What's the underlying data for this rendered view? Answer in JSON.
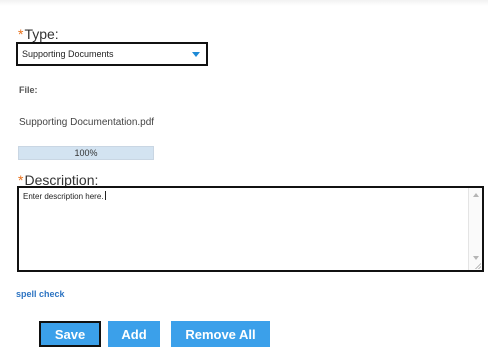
{
  "type_field": {
    "required_marker": "*",
    "label": "Type:",
    "selected": "Supporting Documents",
    "accent_color": "#1e8ad6"
  },
  "file_field": {
    "label": "File:",
    "file_name": "Supporting Documentation.pdf",
    "progress_label": "100%",
    "progress": 1.0
  },
  "description_field": {
    "required_marker": "*",
    "label": "Description:",
    "value": "Enter description here."
  },
  "links": {
    "spell_check": "spell check"
  },
  "buttons": {
    "save": "Save",
    "add": "Add",
    "remove_all": "Remove All",
    "color": "#3ba0ea"
  },
  "icons": {
    "dropdown": "chevron-down-icon",
    "scroll_up": "scroll-up-icon",
    "scroll_down": "scroll-down-icon",
    "resize": "resize-grip-icon"
  }
}
